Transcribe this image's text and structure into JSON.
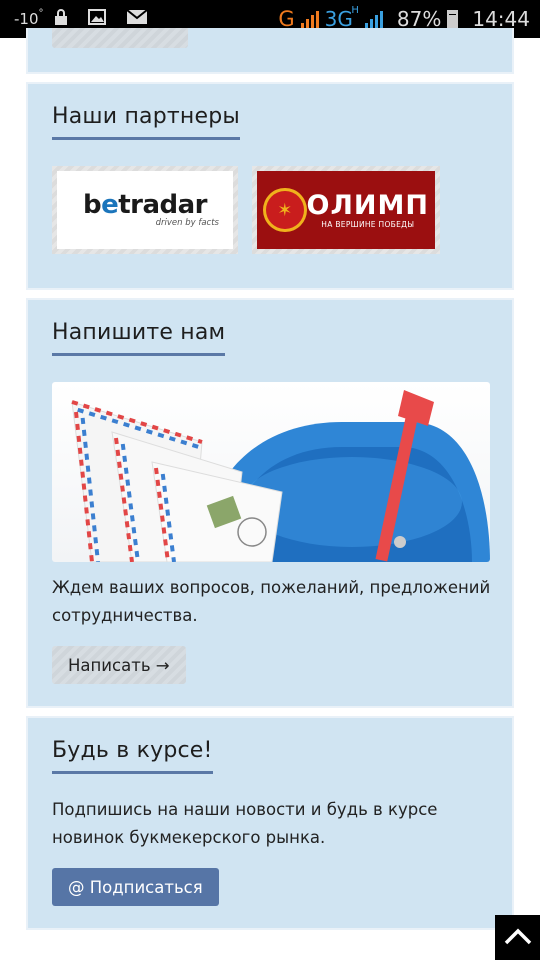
{
  "status_bar": {
    "temperature": "-10",
    "temperature_unit": "°",
    "network_g": "G",
    "network_3g": "3G",
    "network_3g_h": "H",
    "battery_percent": "87%",
    "battery_level": 0.87,
    "time": "14:44",
    "icons": [
      "lock-icon",
      "image-icon",
      "mail-icon",
      "signal-icon",
      "battery-icon"
    ]
  },
  "partners": {
    "title": "Наши партнеры",
    "logos": [
      {
        "name": "betradar",
        "word_b": "b",
        "word_e": "e",
        "word_rest": "tradar",
        "tagline": "driven by facts"
      },
      {
        "name": "olimp",
        "word": "ОЛИМП",
        "tagline": "НА ВЕРШИНЕ ПОБЕДЫ"
      }
    ]
  },
  "contact": {
    "title": "Напишите нам",
    "text": "Ждем ваших вопросов, пожеланий, предложений сотрудничества.",
    "button_label": "Написать →"
  },
  "subscribe": {
    "title": "Будь в курсе!",
    "text": "Подпишись на наши новости и будь в курсе новинок букмекерского рынка.",
    "button_label": "@ Подписаться"
  },
  "colors": {
    "panel_bg": "#d0e4f2",
    "title_underline": "#5a78a6",
    "primary_button": "#5675a6",
    "status_orange": "#f07a1e",
    "status_blue": "#3aa0e0"
  },
  "scroll_top_icon": "chevron-up-icon"
}
